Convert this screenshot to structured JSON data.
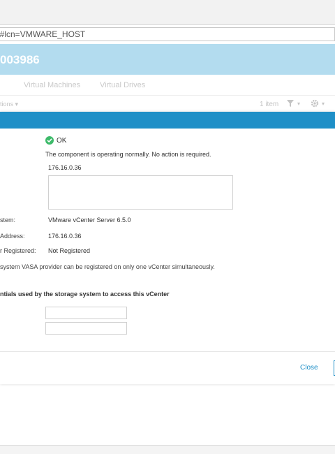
{
  "browser": {
    "address": "l#lcn=VMWARE_HOST"
  },
  "banner": {
    "title": "003986"
  },
  "tabs": [
    {
      "label": "Virtual Machines"
    },
    {
      "label": "Virtual Drives"
    }
  ],
  "toolbar": {
    "actions_label": "tions",
    "count": "1 item"
  },
  "dialog": {
    "status": {
      "text": "OK",
      "color": "#3dba6a",
      "description": "The component is operating normally. No action is required."
    },
    "ip_value": "176.16.0.36",
    "fields": {
      "system_label": "stem:",
      "system_value": "VMware vCenter Server 6.5.0",
      "address_label": "Address:",
      "address_value": "176.16.0.36",
      "registered_label": "r Registered:",
      "registered_value": "Not Registered"
    },
    "note": "system VASA provider can be registered on only one vCenter simultaneously.",
    "credentials_title": "ntials used by the storage system to access this vCenter",
    "footer": {
      "close_label": "Close"
    }
  },
  "colors": {
    "accent": "#1e8fc7",
    "banner": "#b3dcef"
  }
}
